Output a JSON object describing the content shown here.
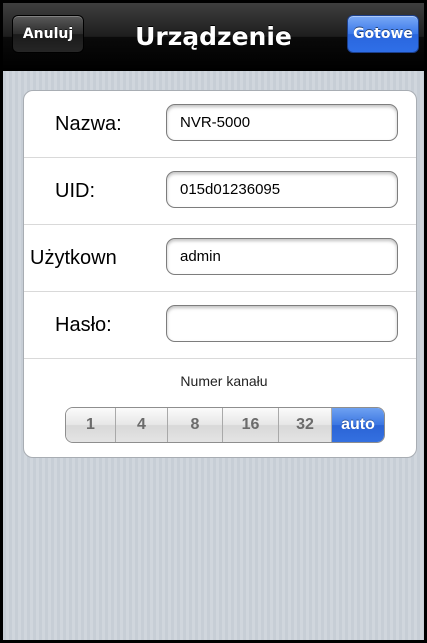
{
  "header": {
    "title": "Urządzenie",
    "cancel_label": "Anuluj",
    "done_label": "Gotowe"
  },
  "form": {
    "name": {
      "label": "Nazwa:",
      "value": "NVR-5000"
    },
    "uid": {
      "label": "UID:",
      "value": "015d01236095"
    },
    "user": {
      "label": "Użytkown",
      "value": "admin"
    },
    "password": {
      "label": "Hasło:",
      "value": ""
    }
  },
  "channel": {
    "caption": "Numer kanału",
    "options": [
      "1",
      "4",
      "8",
      "16",
      "32",
      "auto"
    ],
    "selected": "auto"
  },
  "colors": {
    "accent": "#3b76e2",
    "background": "#c5ccd4"
  }
}
